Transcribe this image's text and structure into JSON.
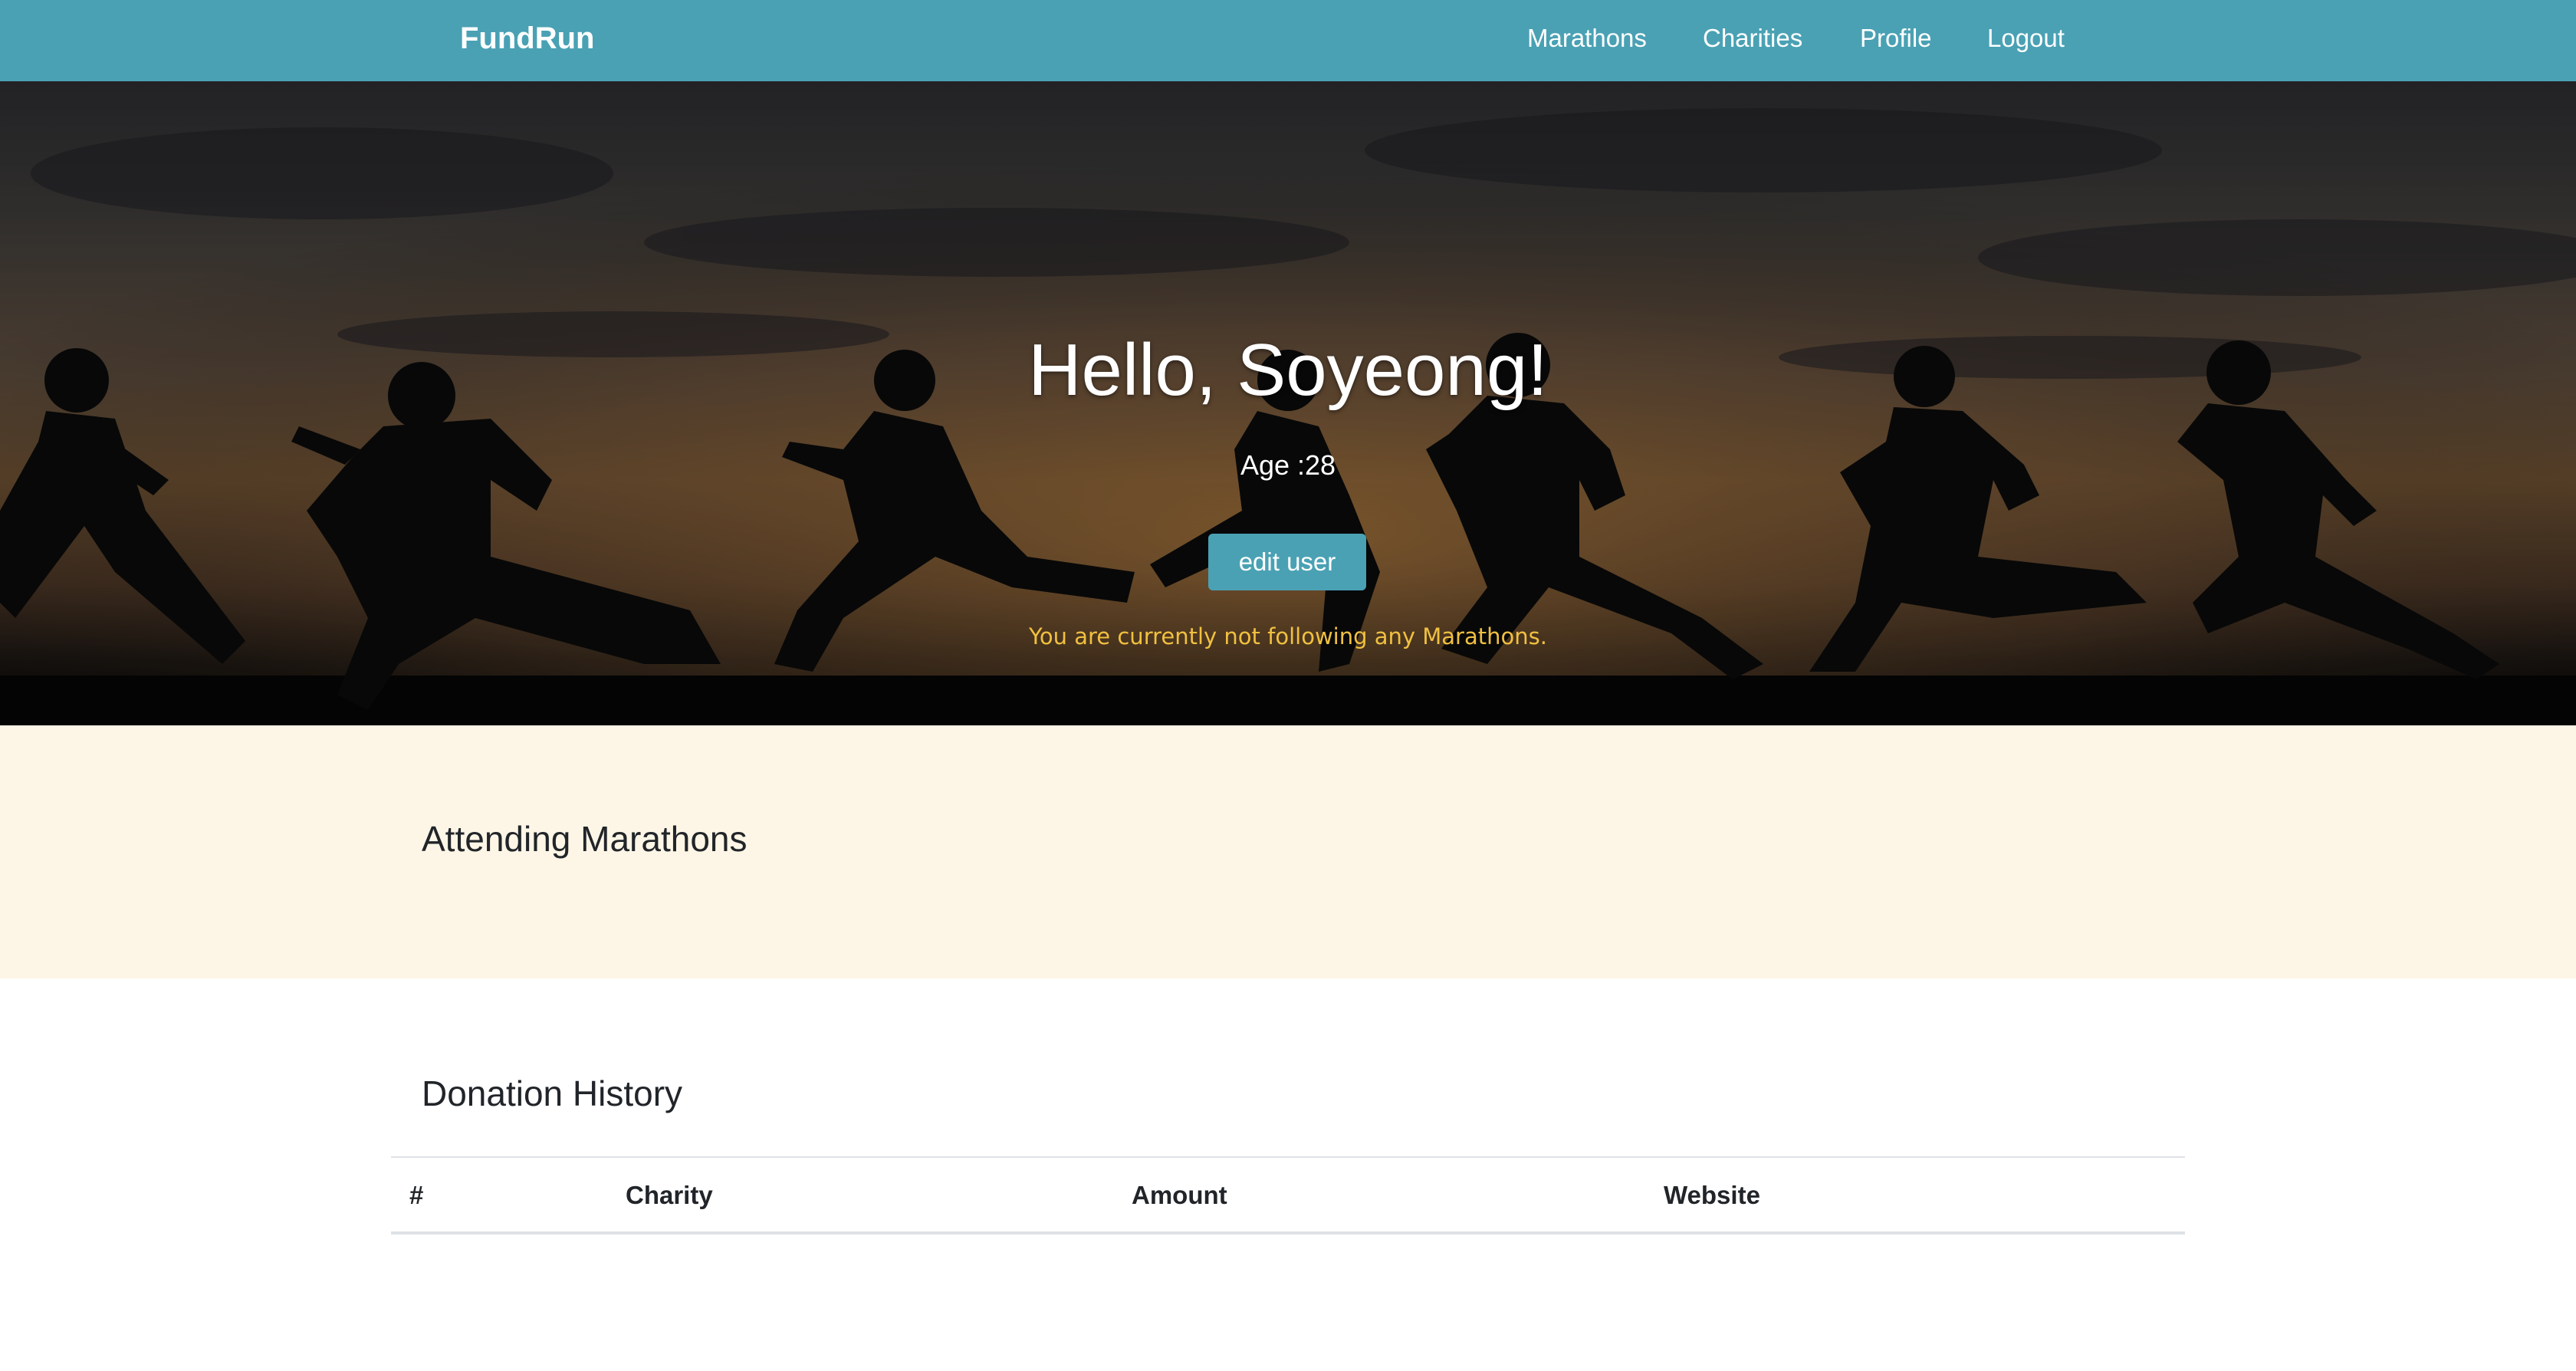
{
  "navbar": {
    "brand": "FundRun",
    "items": [
      {
        "label": "Marathons"
      },
      {
        "label": "Charities"
      },
      {
        "label": "Profile"
      },
      {
        "label": "Logout"
      }
    ],
    "background_color": "#4aa1b4"
  },
  "hero": {
    "title": "Hello, Soyeong!",
    "age": "Age :28",
    "edit_button": "edit user",
    "notice": "You are currently not following any Marathons.",
    "notice_color": "#f0c040",
    "image": "runners-silhouette-sunset"
  },
  "attending": {
    "heading": "Attending Marathons",
    "background_color": "#fdf6e6"
  },
  "donation": {
    "heading": "Donation History",
    "columns": [
      "#",
      "Charity",
      "Amount",
      "Website"
    ],
    "rows": []
  }
}
